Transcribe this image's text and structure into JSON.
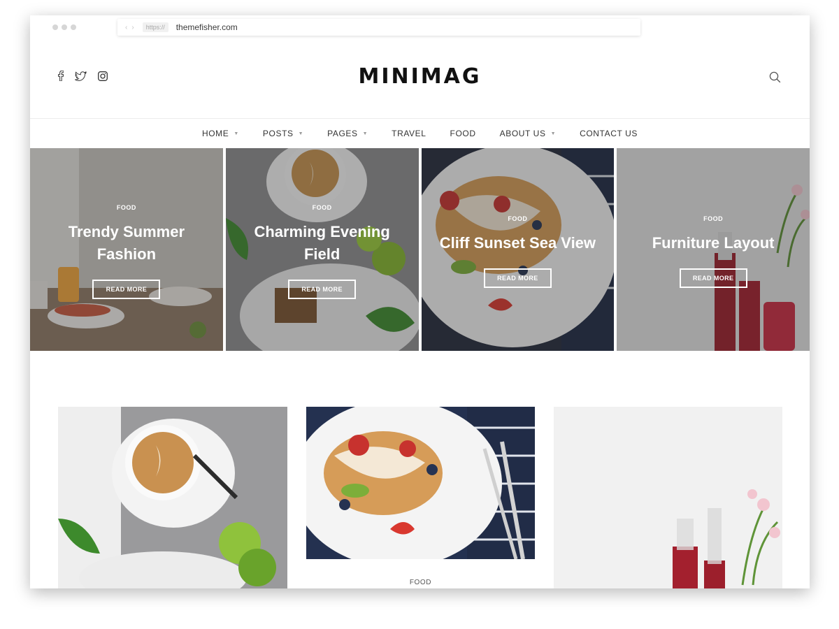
{
  "browser": {
    "protocol": "https://",
    "domain": "themefisher.com",
    "back_icon": "chevron-left-icon",
    "forward_icon": "chevron-right-icon"
  },
  "header": {
    "logo": "MINIMAG",
    "social_icons": [
      "facebook-icon",
      "twitter-icon",
      "instagram-icon"
    ],
    "search_icon": "search-icon"
  },
  "nav": {
    "items": [
      {
        "label": "HOME",
        "dropdown": true
      },
      {
        "label": "POSTS",
        "dropdown": true
      },
      {
        "label": "PAGES",
        "dropdown": true
      },
      {
        "label": "TRAVEL",
        "dropdown": false
      },
      {
        "label": "FOOD",
        "dropdown": false
      },
      {
        "label": "ABOUT US",
        "dropdown": true
      },
      {
        "label": "CONTACT US",
        "dropdown": false
      }
    ]
  },
  "slider": {
    "slides": [
      {
        "category": "FOOD",
        "title": "Trendy Summer Fashion",
        "button": "READ MORE"
      },
      {
        "category": "FOOD",
        "title": "Charming Evening Field",
        "button": "READ MORE"
      },
      {
        "category": "FOOD",
        "title": "Cliff Sunset Sea View",
        "button": "READ MORE"
      },
      {
        "category": "FOOD",
        "title": "Furniture Layout",
        "button": "READ MORE"
      }
    ]
  },
  "posts": {
    "second_card_category": "FOOD"
  },
  "colors": {
    "text_dark": "#111111",
    "overlay": "#282828",
    "accent_white": "#ffffff"
  }
}
